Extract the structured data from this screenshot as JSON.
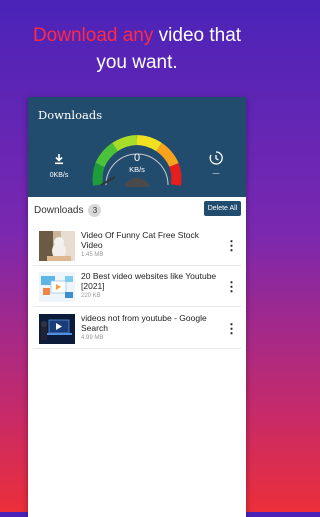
{
  "headline": {
    "part1": "Download any",
    "part2": " video that",
    "line2": "you want.",
    "accent_color": "#ff2a45"
  },
  "toolbar": {
    "title": "Downloads",
    "download_speed": "0KB/s",
    "timer_value": "—",
    "gauge": {
      "value": "0",
      "unit": "KB/s",
      "level": 0
    },
    "background_color": "#224c6e"
  },
  "downloads": {
    "header_label": "Downloads",
    "count": "3",
    "delete_all_label": "Delete All",
    "items": [
      {
        "title": "Video Of Funny Cat  Free Stock Video",
        "size": "1.45 MB",
        "thumbnail": "cat-thumbnail"
      },
      {
        "title": "20 Best video websites like Youtube [2021]",
        "size": "220 KB",
        "thumbnail": "video-sites-thumbnail"
      },
      {
        "title": "videos not from youtube - Google Search",
        "size": "4.99 MB",
        "thumbnail": "laptop-play-thumbnail"
      }
    ]
  },
  "icons": {
    "download": "download-icon",
    "timer": "timer-icon",
    "more": "more-vertical-icon"
  }
}
